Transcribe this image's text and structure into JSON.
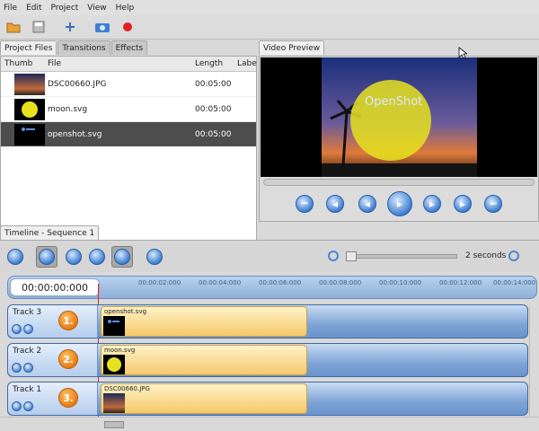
{
  "menu": {
    "items": [
      "File",
      "Edit",
      "Project",
      "View",
      "Help"
    ]
  },
  "left_tabs": [
    "Project Files",
    "Transitions",
    "Effects"
  ],
  "file_table": {
    "headers": [
      "Thumb",
      "File",
      "Length",
      "Labe"
    ],
    "rows": [
      {
        "file": "DSC00660.JPG",
        "length": "00:05:00"
      },
      {
        "file": "moon.svg",
        "length": "00:05:00"
      },
      {
        "file": "openshot.svg",
        "length": "00:05:00"
      }
    ]
  },
  "preview": {
    "tab": "Video Preview",
    "overlay_text": "OpenShot"
  },
  "timeline": {
    "tab": "Timeline - Sequence 1",
    "zoom_label": "2 seconds",
    "timecode": "00:00:00:000",
    "ticks": [
      "00:00:02:000",
      "00:00:04:000",
      "00:00:06:000",
      "00:00:08:000",
      "00:00:10:000",
      "00:00:12:000",
      "00:00:14:000"
    ],
    "tracks": [
      {
        "name": "Track 3",
        "badge": "1.",
        "clip": "openshot.svg"
      },
      {
        "name": "Track 2",
        "badge": "2.",
        "clip": "moon.svg"
      },
      {
        "name": "Track 1",
        "badge": "3.",
        "clip": "DSC00660.JPG"
      }
    ]
  },
  "colors": {
    "accent": "#3f7fd0",
    "clip": "#f5c96b",
    "badge": "#e77c12",
    "selected_row": "#4d4d4d"
  }
}
